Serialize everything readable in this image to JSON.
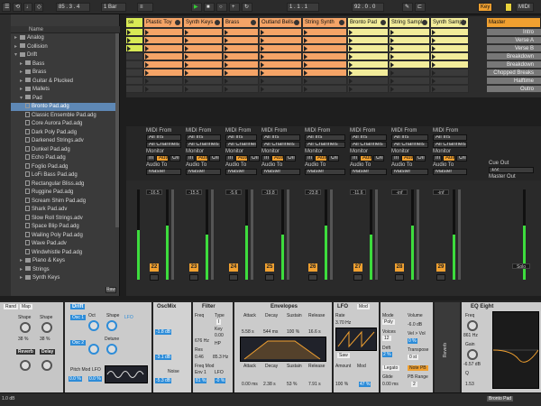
{
  "topbar": {
    "bars": "85 . 3 . 4",
    "quant": "1 Bar",
    "pos": "1 . 1 . 1",
    "tempo": "92 . 0 . 0",
    "key": "Key",
    "midi": "MIDI"
  },
  "browser": {
    "header": "Name",
    "items": [
      {
        "label": "Analog",
        "type": "folder",
        "arrow": "▸"
      },
      {
        "label": "Collision",
        "type": "folder",
        "arrow": "▸"
      },
      {
        "label": "Drift",
        "type": "folder",
        "arrow": "▾"
      },
      {
        "label": "Bass",
        "type": "folder",
        "arrow": "▸"
      },
      {
        "label": "Brass",
        "type": "folder",
        "arrow": "▸"
      },
      {
        "label": "Guitar & Plucked",
        "type": "folder",
        "arrow": "▸"
      },
      {
        "label": "Mallets",
        "type": "folder",
        "arrow": "▸"
      },
      {
        "label": "Pad",
        "type": "folder",
        "arrow": "▾"
      },
      {
        "label": "Bronto Pad.adg",
        "type": "file",
        "selected": true
      },
      {
        "label": "Classic Ensemble Pad.adg",
        "type": "file"
      },
      {
        "label": "Core Aurora Pad.adg",
        "type": "file"
      },
      {
        "label": "Dark Poly Pad.adg",
        "type": "file"
      },
      {
        "label": "Darkened Strings.adv",
        "type": "file"
      },
      {
        "label": "Dunkel Pad.adg",
        "type": "file"
      },
      {
        "label": "Echo Pad.adg",
        "type": "file"
      },
      {
        "label": "Foglio Pad.adg",
        "type": "file"
      },
      {
        "label": "LoFi Bass Pad.adg",
        "type": "file"
      },
      {
        "label": "Rectangular Bliss.adg",
        "type": "file"
      },
      {
        "label": "Ruggine Pad.adg",
        "type": "file"
      },
      {
        "label": "Scream Shim Pad.adg",
        "type": "file"
      },
      {
        "label": "Shark Pad.adv",
        "type": "file"
      },
      {
        "label": "Slow Roll Strings.adv",
        "type": "file"
      },
      {
        "label": "Space Blip Pad.adg",
        "type": "file"
      },
      {
        "label": "Wailing Poly Pad.adg",
        "type": "file"
      },
      {
        "label": "Wave Pad.adv",
        "type": "file"
      },
      {
        "label": "Windwhistle Pad.adg",
        "type": "file"
      },
      {
        "label": "Piano & Keys",
        "type": "folder",
        "arrow": "▸"
      },
      {
        "label": "Strings",
        "type": "folder",
        "arrow": "▸"
      },
      {
        "label": "Synth Keys",
        "type": "folder",
        "arrow": "▸"
      }
    ],
    "raw": "Raw"
  },
  "tracks": [
    {
      "name": "se",
      "color": "#d8ea55",
      "vol": "",
      "num": ""
    },
    {
      "name": "Plastic Toy",
      "color": "#f5a467",
      "vol": "-16.5",
      "num": "22"
    },
    {
      "name": "Synth Keys",
      "color": "#f5a467",
      "vol": "-15.5",
      "num": "23"
    },
    {
      "name": "Brass",
      "color": "#f5a467",
      "vol": "-5.6",
      "num": "24"
    },
    {
      "name": "Outland Bells",
      "color": "#f5a467",
      "vol": "-19.8",
      "num": "25"
    },
    {
      "name": "String Synth",
      "color": "#f5a467",
      "vol": "-23.8",
      "num": "26"
    },
    {
      "name": "Bronto Pad",
      "color": "#f2ec9a",
      "vol": "-11.6",
      "num": "27"
    },
    {
      "name": "String Sample",
      "color": "#f2ec9a",
      "vol": "-inf",
      "num": "28"
    },
    {
      "name": "Synth Sample",
      "color": "#f2ec9a",
      "vol": "-inf",
      "num": "29"
    }
  ],
  "master": {
    "name": "Master",
    "scenes": [
      "Intro",
      "Verse A",
      "Verse B",
      "Breakdown",
      "Breakdown",
      "Chopped Breaks",
      "Halftime",
      "Outro"
    ],
    "cue_out": "Cue Out",
    "cue_val": "1/2",
    "master_out": "Master Out",
    "master_val": "1/2",
    "solo": "Solo"
  },
  "io": {
    "midi_from": "MIDI From",
    "all_ins": "All Ins",
    "all_channels": "All Channels",
    "monitor": "Monitor",
    "in": "In",
    "auto": "Auto",
    "off": "Off",
    "audio_to": "Audio To",
    "master": "Master"
  },
  "device": {
    "drift": "Drift",
    "osc1": "Osc 1",
    "osc2": "Osc 2",
    "oct": "Oct",
    "shape": "Shape",
    "lfo": "LFO",
    "detune": "Detune",
    "noise": "Noise",
    "pitch_mod": "Pitch Mod",
    "lfo_small": "LFO",
    "mod_val1": "0.0 %",
    "mod_val2": "0.0 %",
    "oscmix": "OscMix",
    "mix_v1": "-1.8 dB",
    "mix_v2": "-3.1 dB",
    "mix_v3": "-5.3 dB",
    "filter": "Filter",
    "freq": "Freq",
    "type": "Type",
    "type_v": "I",
    "key": "Key",
    "key_v": "0.00",
    "freq_v": "676 Hz",
    "hp": "HP",
    "res": "Res",
    "res_v": "0.46",
    "hp_v": "85.3 Hz",
    "freqmod": "Freq Mod",
    "env1": "Env 1",
    "lfo_mod": "LFO",
    "fm_v1": "81 %",
    "fm_v2": "-0 %",
    "envelopes": "Envelopes",
    "attack": "Attack",
    "decay": "Decay",
    "sustain": "Sustain",
    "release": "Release",
    "a_v": "5.58 s",
    "d_v": "544 ms",
    "s_v": "100 %",
    "r_v": "16.6 s",
    "a2_v": "0.00 ms",
    "d2_v": "2.38 s",
    "s2_v": "53 %",
    "r2_v": "7.91 s",
    "lfo_panel": "LFO",
    "mod": "Mod",
    "rate": "Rate",
    "rate_v": "3.70 Hz",
    "saw": "Saw",
    "amount": "Amount",
    "amount_v": "100 %",
    "mod_v": "Mod",
    "mod_pct": "47 %",
    "mode": "Mode",
    "mode_v": "Poly",
    "voices": "Voices",
    "voices_v": "12",
    "drift_v": "2 %",
    "legato": "Legato",
    "glide": "Glide",
    "glide_v": "0.00 ms",
    "volume": "Volume",
    "volume_v": "-6.0 dB",
    "vel_vol": "Vel > Vol",
    "vel_v": "0 %",
    "transpose": "Transpose",
    "trans_v": "0 st",
    "note_pb": "Note PB",
    "pb_range": "PB Range",
    "pb_v": "2",
    "eq": "EQ Eight",
    "eq_freq": "Freq",
    "eq_freq_v": "861 Hz",
    "eq_gain": "Gain",
    "eq_gain_v": "-6.57 dB",
    "eq_q": "Q",
    "eq_q_v": "1.53",
    "left_labels": [
      "Shape",
      "Shape",
      "Reverb",
      "Delay"
    ],
    "left_vals": [
      "38 %",
      "38 %"
    ],
    "rack_map": "Map",
    "rack_rand": "Rand",
    "verb": "Reverb"
  },
  "status": {
    "left": "1.0 dB",
    "right": "Bronto Pad"
  }
}
